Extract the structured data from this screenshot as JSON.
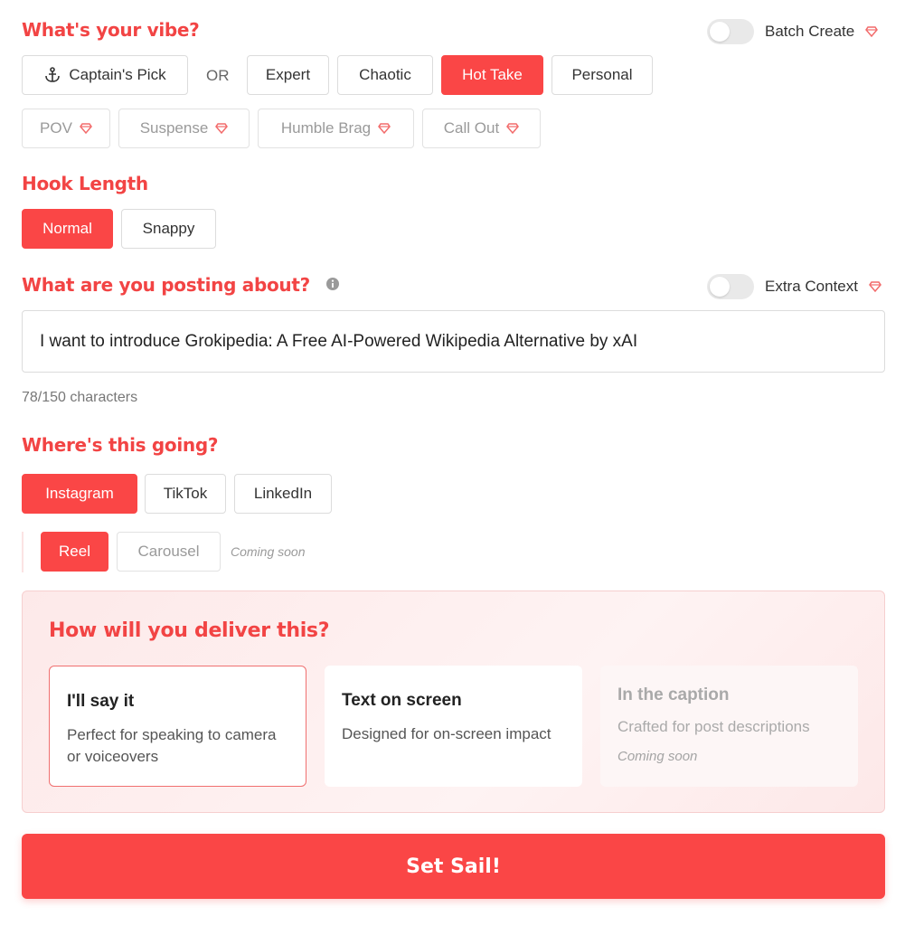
{
  "vibe": {
    "title": "What's your vibe?",
    "batch_create_label": "Batch Create",
    "captains_pick": "Captain's Pick",
    "or_text": "OR",
    "options": [
      "Expert",
      "Chaotic",
      "Hot Take",
      "Personal"
    ],
    "selected": "Hot Take",
    "premium_options": [
      "POV",
      "Suspense",
      "Humble Brag",
      "Call Out"
    ]
  },
  "hook_length": {
    "title": "Hook Length",
    "options": [
      "Normal",
      "Snappy"
    ],
    "selected": "Normal"
  },
  "posting": {
    "title": "What are you posting about?",
    "extra_context_label": "Extra Context",
    "input_value": "I want to introduce Grokipedia: A Free AI-Powered Wikipedia Alternative by xAI",
    "char_count": "78/150 characters"
  },
  "destination": {
    "title": "Where's this going?",
    "platforms": [
      "Instagram",
      "TikTok",
      "LinkedIn"
    ],
    "selected_platform": "Instagram",
    "formats": [
      "Reel",
      "Carousel"
    ],
    "selected_format": "Reel",
    "coming_soon": "Coming soon"
  },
  "delivery": {
    "title": "How will you deliver this?",
    "cards": [
      {
        "title": "I'll say it",
        "desc": "Perfect for speaking to camera or voiceovers"
      },
      {
        "title": "Text on screen",
        "desc": "Designed for on-screen impact"
      },
      {
        "title": "In the caption",
        "desc": "Crafted for post descriptions",
        "note": "Coming soon"
      }
    ],
    "selected": "I'll say it"
  },
  "submit_label": "Set Sail!",
  "colors": {
    "accent": "#fa4646",
    "title": "#f24444",
    "premium_gem": "#f26b6b"
  }
}
